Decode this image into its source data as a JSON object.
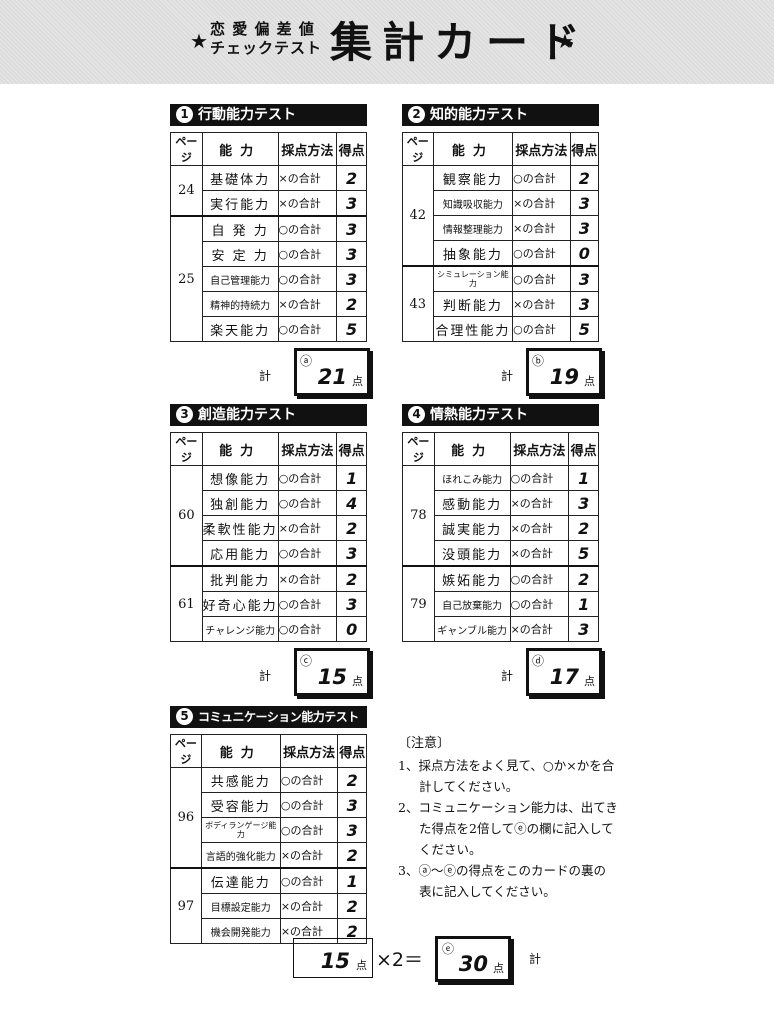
{
  "header": {
    "star": "★",
    "subtitle_line1": "恋 愛 偏 差 値",
    "subtitle_line2": "チェックテスト",
    "title": "集計カード"
  },
  "columns": {
    "page": "ページ",
    "ability": "能力",
    "method": "採点方法",
    "score": "得点"
  },
  "total_label": "計",
  "unit": "点",
  "sections": [
    {
      "num": "1",
      "title": "行動能力テスト",
      "groups": [
        {
          "page": "24",
          "rows": [
            {
              "ability": "基礎体力",
              "method": "×の合計",
              "score": "2"
            },
            {
              "ability": "実行能力",
              "method": "×の合計",
              "score": "3"
            }
          ]
        },
        {
          "page": "25",
          "rows": [
            {
              "ability": "自 発 力",
              "method": "○の合計",
              "score": "3"
            },
            {
              "ability": "安 定 力",
              "method": "○の合計",
              "score": "3"
            },
            {
              "ability": "自己管理能力",
              "method": "○の合計",
              "score": "3"
            },
            {
              "ability": "精神的持続力",
              "method": "×の合計",
              "score": "2"
            },
            {
              "ability": "楽天能力",
              "method": "○の合計",
              "score": "5"
            }
          ]
        }
      ],
      "total_letter": "ⓐ",
      "total": "21"
    },
    {
      "num": "2",
      "title": "知的能力テスト",
      "groups": [
        {
          "page": "42",
          "rows": [
            {
              "ability": "観察能力",
              "method": "○の合計",
              "score": "2"
            },
            {
              "ability": "知識吸収能力",
              "method": "×の合計",
              "score": "3"
            },
            {
              "ability": "情報整理能力",
              "method": "×の合計",
              "score": "3"
            },
            {
              "ability": "抽象能力",
              "method": "○の合計",
              "score": "0"
            }
          ]
        },
        {
          "page": "43",
          "rows": [
            {
              "ability": "シミュレーション能力",
              "method": "○の合計",
              "score": "3"
            },
            {
              "ability": "判断能力",
              "method": "×の合計",
              "score": "3"
            },
            {
              "ability": "合理性能力",
              "method": "○の合計",
              "score": "5"
            }
          ]
        }
      ],
      "total_letter": "ⓑ",
      "total": "19"
    },
    {
      "num": "3",
      "title": "創造能力テスト",
      "groups": [
        {
          "page": "60",
          "rows": [
            {
              "ability": "想像能力",
              "method": "○の合計",
              "score": "1"
            },
            {
              "ability": "独創能力",
              "method": "○の合計",
              "score": "4"
            },
            {
              "ability": "柔軟性能力",
              "method": "×の合計",
              "score": "2"
            },
            {
              "ability": "応用能力",
              "method": "○の合計",
              "score": "3"
            }
          ]
        },
        {
          "page": "61",
          "rows": [
            {
              "ability": "批判能力",
              "method": "×の合計",
              "score": "2"
            },
            {
              "ability": "好奇心能力",
              "method": "○の合計",
              "score": "3"
            },
            {
              "ability": "チャレンジ能力",
              "method": "○の合計",
              "score": "0"
            }
          ]
        }
      ],
      "total_letter": "ⓒ",
      "total": "15"
    },
    {
      "num": "4",
      "title": "情熱能力テスト",
      "groups": [
        {
          "page": "78",
          "rows": [
            {
              "ability": "ほれこみ能力",
              "method": "○の合計",
              "score": "1"
            },
            {
              "ability": "感動能力",
              "method": "×の合計",
              "score": "3"
            },
            {
              "ability": "誠実能力",
              "method": "×の合計",
              "score": "2"
            },
            {
              "ability": "没頭能力",
              "method": "×の合計",
              "score": "5"
            }
          ]
        },
        {
          "page": "79",
          "rows": [
            {
              "ability": "嫉妬能力",
              "method": "○の合計",
              "score": "2"
            },
            {
              "ability": "自己放棄能力",
              "method": "○の合計",
              "score": "1"
            },
            {
              "ability": "ギャンブル能力",
              "method": "×の合計",
              "score": "3"
            }
          ]
        }
      ],
      "total_letter": "ⓓ",
      "total": "17"
    },
    {
      "num": "5",
      "title": "コミュニケーション能力テスト",
      "groups": [
        {
          "page": "96",
          "rows": [
            {
              "ability": "共感能力",
              "method": "○の合計",
              "score": "2"
            },
            {
              "ability": "受容能力",
              "method": "○の合計",
              "score": "3"
            },
            {
              "ability": "ボディランゲージ能力",
              "method": "○の合計",
              "score": "3"
            },
            {
              "ability": "言語的強化能力",
              "method": "×の合計",
              "score": "2"
            }
          ]
        },
        {
          "page": "97",
          "rows": [
            {
              "ability": "伝達能力",
              "method": "○の合計",
              "score": "1"
            },
            {
              "ability": "目標設定能力",
              "method": "×の合計",
              "score": "2"
            },
            {
              "ability": "機会開発能力",
              "method": "×の合計",
              "score": "2"
            }
          ]
        }
      ],
      "total_letter": "",
      "total": ""
    }
  ],
  "notes": {
    "title": "〔注意〕",
    "items": [
      "1、採点方法をよく見て、○か×かを合計してください。",
      "2、コミュニケーション能力は、出てきた得点を2倍してⓔの欄に記入してください。",
      "3、ⓐ～ⓔの得点をこのカードの裏の表に記入してください。"
    ]
  },
  "bottom": {
    "raw": "15",
    "multiplier": "×2＝",
    "letter": "ⓔ",
    "result": "30"
  }
}
